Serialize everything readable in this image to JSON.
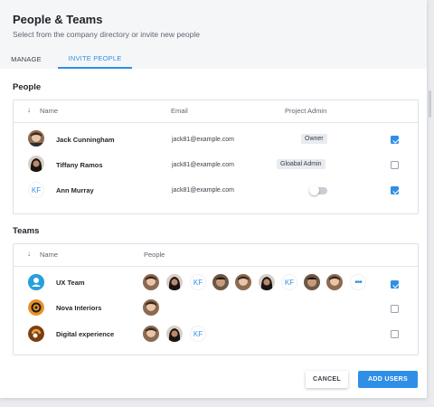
{
  "dialog": {
    "title": "People & Teams",
    "subtitle": "Select from the company directory or invite new people"
  },
  "tabs": [
    {
      "label": "MANAGE",
      "active": false
    },
    {
      "label": "INVITE PEOPLE",
      "active": true
    }
  ],
  "people": {
    "section_label": "People",
    "columns": {
      "name": "Name",
      "email": "Email",
      "project_admin": "Project Admin"
    },
    "rows": [
      {
        "name": "Jack Cunningham",
        "email": "jack81@example.com",
        "role": "Owner",
        "checked": true
      },
      {
        "name": "Tiffany Ramos",
        "email": "jack81@example.com",
        "role": "Gloabal Admin",
        "checked": false
      },
      {
        "name": "Ann Murray",
        "email": "jack81@example.com",
        "initials": "KF",
        "admin_toggle": "off",
        "checked": true
      }
    ]
  },
  "teams": {
    "section_label": "Teams",
    "columns": {
      "name": "Name",
      "people": "People"
    },
    "rows": [
      {
        "name": "UX Team",
        "member_initials": [
          "KF",
          "KF"
        ],
        "checked": true
      },
      {
        "name": "Nova Interiors",
        "checked": false
      },
      {
        "name": "Digital experience",
        "member_initials": [
          "KF"
        ],
        "checked": false
      }
    ]
  },
  "footer": {
    "cancel_label": "CANCEL",
    "add_label": "ADD USERS"
  },
  "colors": {
    "accent": "#2f8fe6",
    "header_bg": "#f5f6f8"
  }
}
